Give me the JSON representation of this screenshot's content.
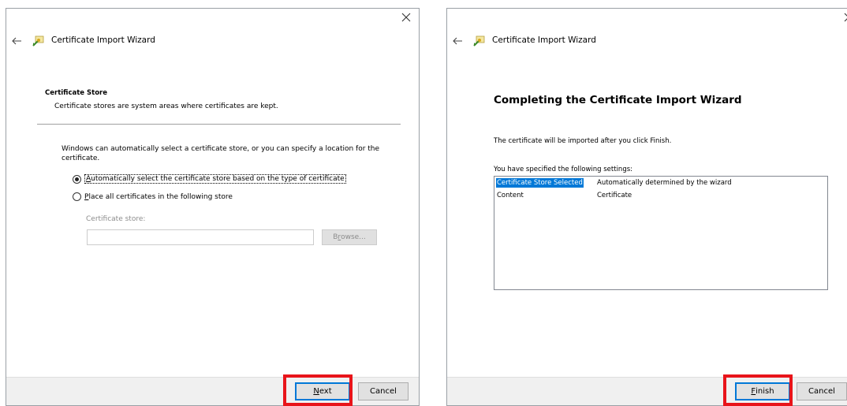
{
  "left_dialog": {
    "title": "Certificate Import Wizard",
    "section_title": "Certificate Store",
    "section_subtitle": "Certificate stores are system areas where certificates are kept.",
    "description": "Windows can automatically select a certificate store, or you can specify a location for the certificate.",
    "radio_auto": {
      "accel": "A",
      "label_rest": "utomatically select the certificate store based on the type of certificate",
      "checked": true
    },
    "radio_place": {
      "accel": "P",
      "label_rest": "lace all certificates in the following store",
      "checked": false
    },
    "store_label": "Certificate store:",
    "store_value": "",
    "browse": {
      "accel": "r",
      "pre": "B",
      "post": "owse..."
    },
    "next": {
      "accel": "N",
      "rest": "ext"
    },
    "cancel": "Cancel"
  },
  "right_dialog": {
    "title": "Certificate Import Wizard",
    "heading": "Completing the Certificate Import Wizard",
    "info": "The certificate will be imported after you click Finish.",
    "settings_label": "You have specified the following settings:",
    "settings": [
      {
        "key": "Certificate Store Selected",
        "value": "Automatically determined by the wizard"
      },
      {
        "key": "Content",
        "value": "Certificate"
      }
    ],
    "finish": {
      "accel": "F",
      "rest": "inish"
    },
    "cancel": "Cancel"
  },
  "colors": {
    "highlight": "#e8141a",
    "selection": "#0078d7",
    "footer_bg": "#f0f0f0"
  }
}
